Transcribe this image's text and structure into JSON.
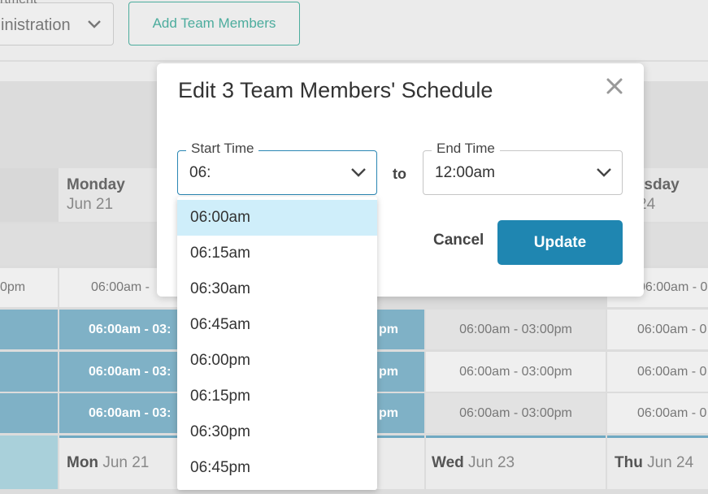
{
  "header": {
    "department_label": "rtment",
    "department_value": "inistration",
    "add_button": "Add Team Members"
  },
  "schedule": {
    "day_headers": [
      {
        "day": "Monday",
        "date": "Jun 21"
      },
      {
        "day": "rsday",
        "date": "24"
      }
    ],
    "row0": [
      "0pm",
      "06:00am -",
      "06:00am - 0"
    ],
    "rows": [
      {
        "mon": "06:00am - 03:",
        "tue_tail": "pm",
        "wed": "06:00am - 03:00pm",
        "thu": "06:00am - 0"
      },
      {
        "mon": "06:00am - 03:",
        "tue_tail": "pm",
        "wed": "06:00am - 03:00pm",
        "thu": "06:00am - 0"
      },
      {
        "mon": "06:00am - 03:",
        "tue_tail": "pm",
        "wed": "06:00am - 03:00pm",
        "thu": "06:00am - 0"
      }
    ],
    "footer_days": [
      {
        "day": "Mon",
        "date": "Jun 21"
      },
      {
        "day": "Wed",
        "date": "Jun 23"
      },
      {
        "day": "Thu",
        "date": "Jun 24"
      }
    ]
  },
  "modal": {
    "title": "Edit 3 Team Members' Schedule",
    "start_label": "Start Time",
    "start_value": "06:",
    "to_label": "to",
    "end_label": "End Time",
    "end_value": "12:00am",
    "cancel": "Cancel",
    "update": "Update"
  },
  "dropdown": {
    "options": [
      "06:00am",
      "06:15am",
      "06:30am",
      "06:45am",
      "06:00pm",
      "06:15pm",
      "06:30pm",
      "06:45pm"
    ],
    "highlighted": "06:00am"
  },
  "colors": {
    "accent": "#1f86b1",
    "teal": "#4cac9d",
    "shift_blue": "#7fb1c6",
    "highlight": "#cfeefa"
  }
}
